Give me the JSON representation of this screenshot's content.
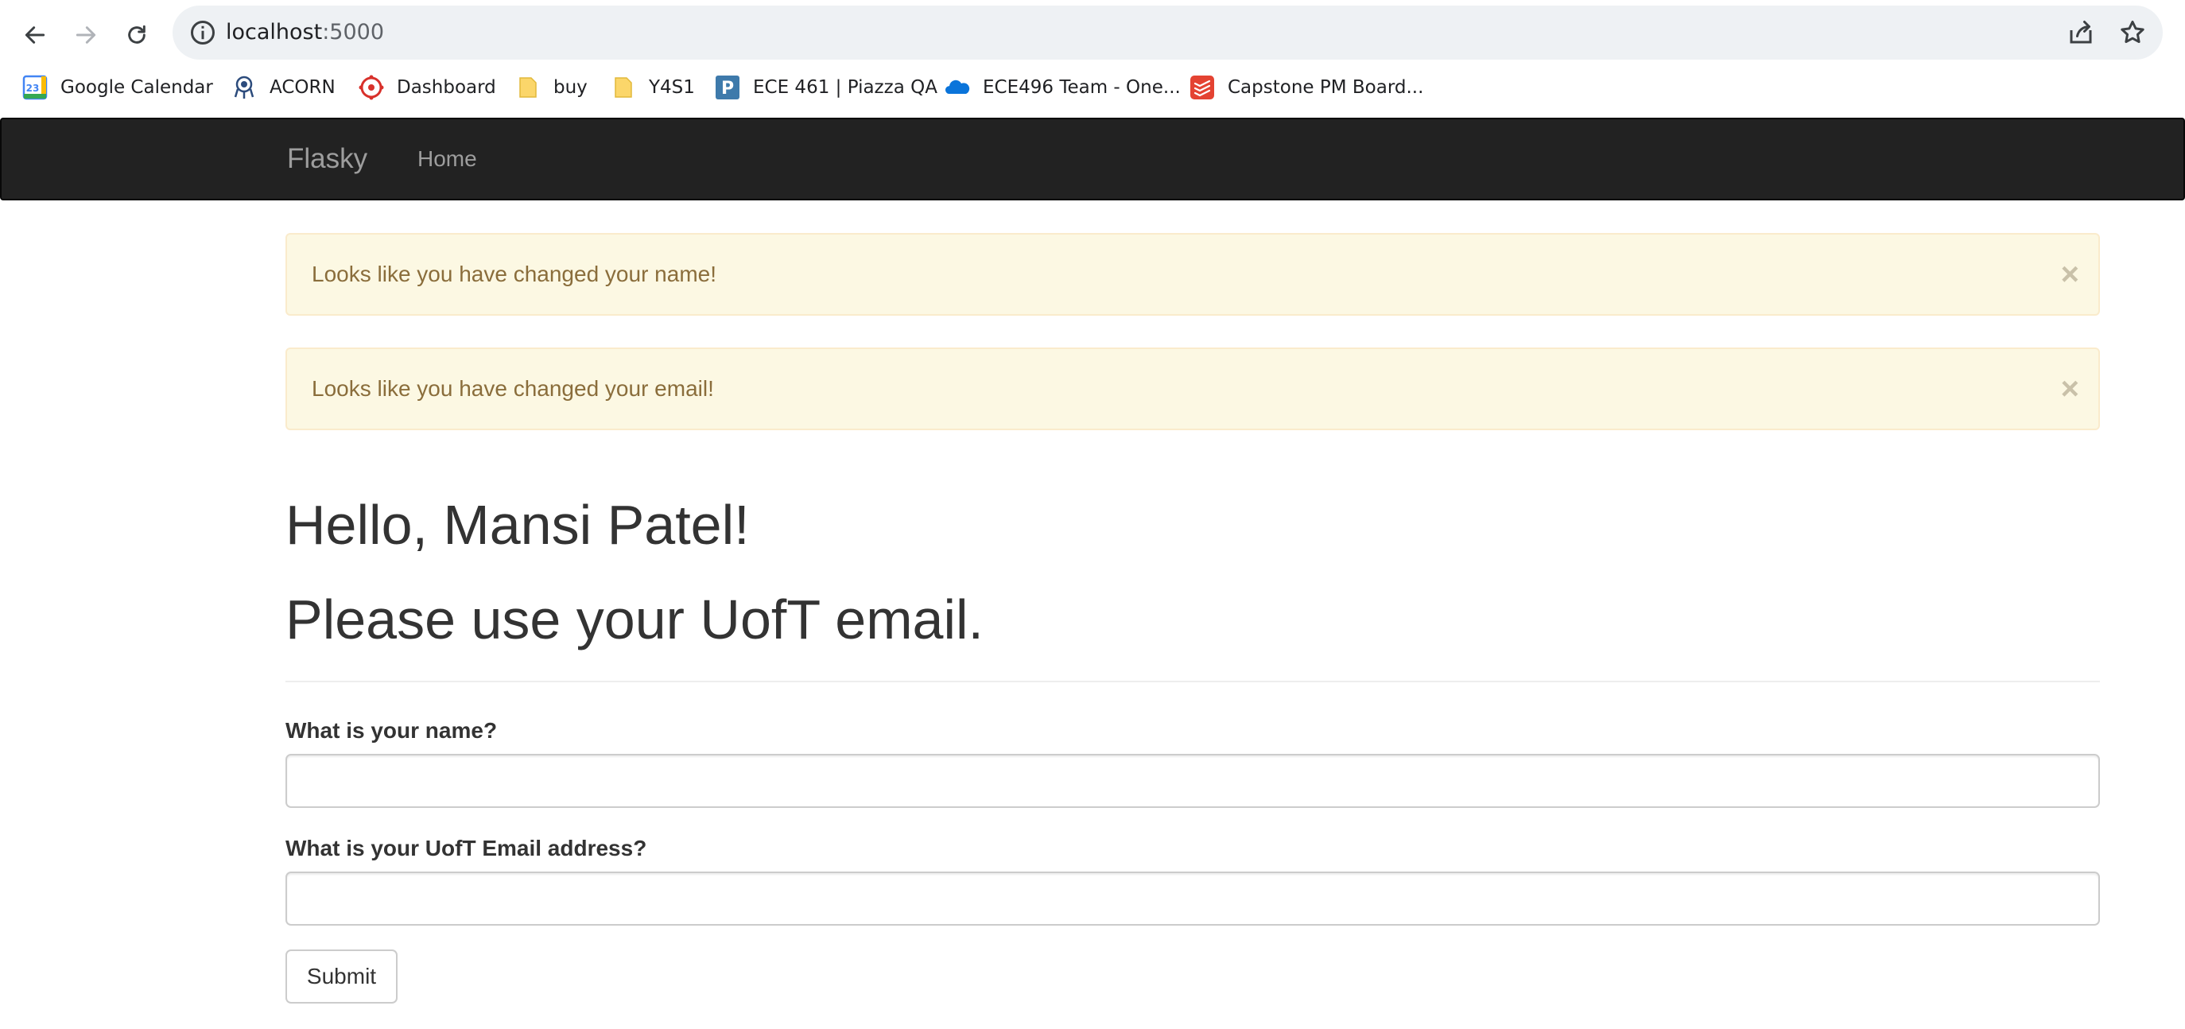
{
  "browser": {
    "address_host": "localhost",
    "address_port": ":5000",
    "bookmarks": [
      {
        "label": "Google Calendar",
        "icon": "google-calendar-icon",
        "icon_text": "23"
      },
      {
        "label": "ACORN",
        "icon": "acorn-icon"
      },
      {
        "label": "Dashboard",
        "icon": "dashboard-icon"
      },
      {
        "label": "buy",
        "icon": "folder-icon"
      },
      {
        "label": "Y4S1",
        "icon": "folder-icon"
      },
      {
        "label": "ECE 461 | Piazza QA",
        "icon": "piazza-icon",
        "icon_text": "P"
      },
      {
        "label": "ECE496 Team - One...",
        "icon": "onedrive-icon"
      },
      {
        "label": "Capstone PM Board...",
        "icon": "todoist-icon"
      }
    ]
  },
  "navbar": {
    "brand": "Flasky",
    "home_link": "Home"
  },
  "alerts": [
    {
      "text": "Looks like you have changed your name!",
      "close": "×"
    },
    {
      "text": "Looks like you have changed your email!",
      "close": "×"
    }
  ],
  "page": {
    "greeting": "Hello, Mansi Patel!",
    "notice": "Please use your UofT email."
  },
  "form": {
    "name_label": "What is your name?",
    "name_value": "",
    "email_label": "What is your UofT Email address?",
    "email_value": "",
    "submit_label": "Submit"
  },
  "colors": {
    "navbar_bg": "#222222",
    "alert_bg": "#fcf8e3",
    "alert_border": "#faebcc",
    "alert_text": "#8a6d3b"
  }
}
